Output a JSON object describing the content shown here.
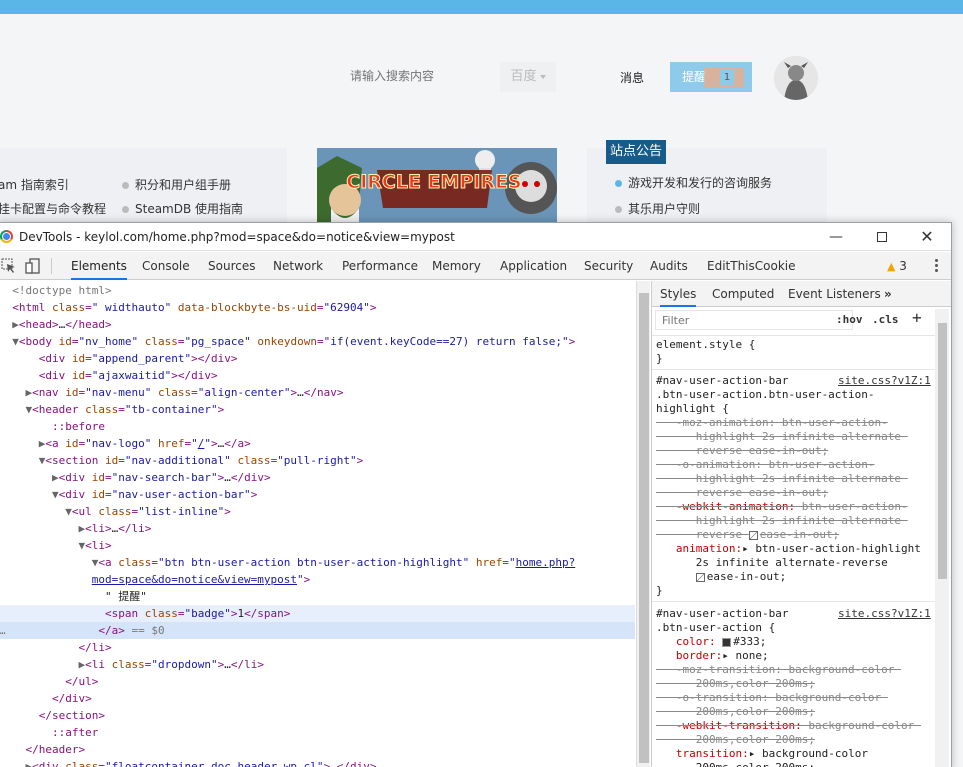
{
  "site": {
    "search_placeholder": "请输入搜索内容",
    "search_engine": "百度",
    "messages": "消息",
    "remind": "提醒",
    "remind_count": "1",
    "left_links": [
      "am 指南索引",
      "积分和用户组手册",
      "挂卡配置与命令教程",
      "SteamDB 使用指南"
    ],
    "banner_text": "CIRCLE EMPIRES",
    "notice_title": "站点公告",
    "notice_items": [
      "游戏开发和发行的咨询服务",
      "其乐用户守则"
    ]
  },
  "devtools": {
    "title": "DevTools - keylol.com/home.php?mod=space&do=notice&view=mypost",
    "tabs": [
      "Elements",
      "Console",
      "Sources",
      "Network",
      "Performance",
      "Memory",
      "Application",
      "Security",
      "Audits",
      "EditThisCookie"
    ],
    "warning_count": "3",
    "styles_tabs": [
      "Styles",
      "Computed",
      "Event Listeners"
    ],
    "filter_placeholder": "Filter",
    "hov": ":hov",
    "cls": ".cls",
    "rule1_source": "site.css?v1Z:1",
    "rule2_source": "site.css?v1Z:1"
  },
  "colors": {
    "topbar": "#5bb6e8",
    "remind_button": "#8ecae9",
    "notice_title_bg": "#175b8a",
    "selected_row": "#d6e4fa",
    "tab_underline": "#1a73e8"
  }
}
